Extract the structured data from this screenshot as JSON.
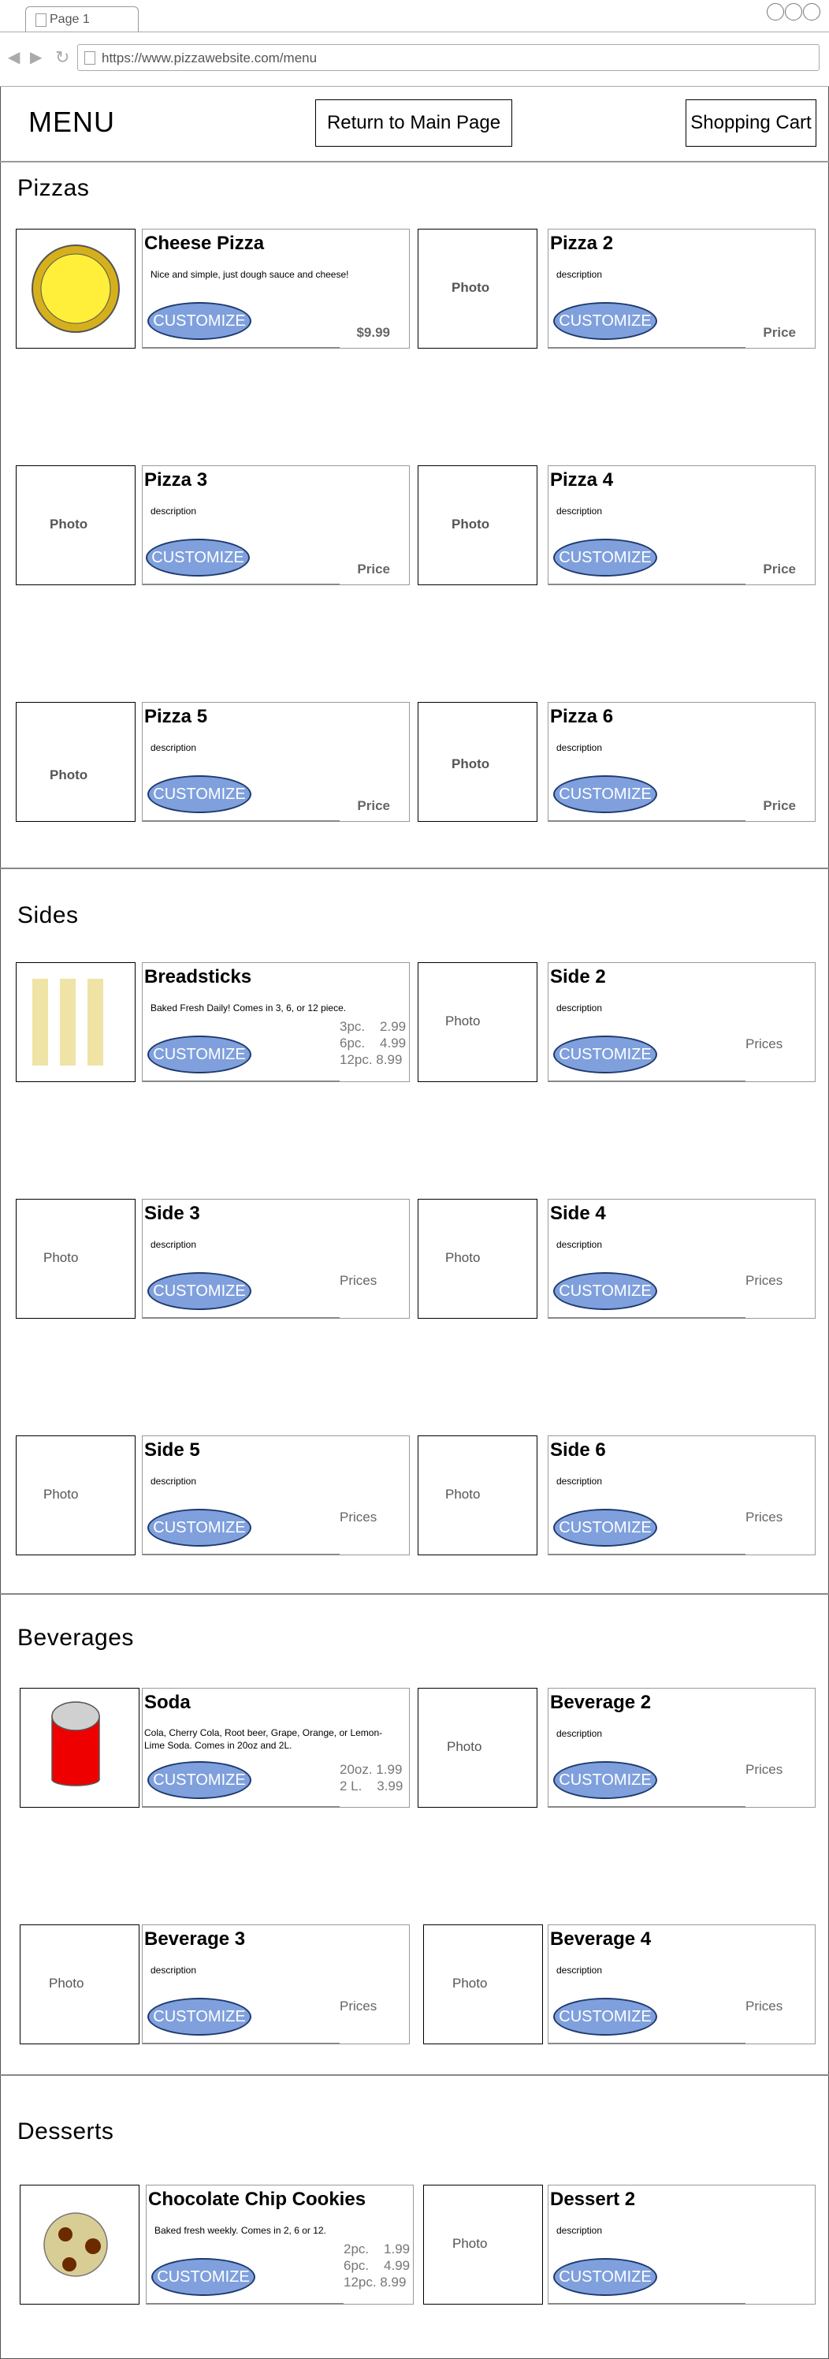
{
  "browser": {
    "tab_label": "Page 1",
    "url": "https://www.pizzawebsite.com/menu",
    "back_icon": "◀",
    "forward_icon": "▶",
    "reload_icon": "↻"
  },
  "header": {
    "title": "MENU",
    "return_button": "Return to Main Page",
    "cart_button": "Shopping Cart"
  },
  "customize_label": "CUSTOMIZE",
  "photo_label": "Photo",
  "sections": {
    "pizzas": {
      "title": "Pizzas",
      "items": [
        {
          "name": "Cheese Pizza",
          "description": "Nice and simple, just dough sauce and cheese!",
          "price": "$9.99"
        },
        {
          "name": "Pizza 2",
          "description": "description",
          "price": "Price"
        },
        {
          "name": "Pizza 3",
          "description": "description",
          "price": "Price"
        },
        {
          "name": "Pizza 4",
          "description": "description",
          "price": "Price"
        },
        {
          "name": "Pizza 5",
          "description": "description",
          "price": "Price"
        },
        {
          "name": "Pizza 6",
          "description": "description",
          "price": "Price"
        }
      ]
    },
    "sides": {
      "title": "Sides",
      "items": [
        {
          "name": "Breadsticks",
          "description": "Baked Fresh Daily! Comes in 3, 6, or 12 piece.",
          "prices": "3pc.    2.99\n6pc.    4.99\n12pc. 8.99"
        },
        {
          "name": "Side 2",
          "description": "description",
          "prices": "Prices"
        },
        {
          "name": "Side 3",
          "description": "description",
          "prices": "Prices"
        },
        {
          "name": "Side 4",
          "description": "description",
          "prices": "Prices"
        },
        {
          "name": "Side 5",
          "description": "description",
          "prices": "Prices"
        },
        {
          "name": "Side 6",
          "description": "description",
          "prices": "Prices"
        }
      ]
    },
    "beverages": {
      "title": "Beverages",
      "items": [
        {
          "name": "Soda",
          "description": "Cola, Cherry Cola, Root beer, Grape, Orange, or Lemon-Lime Soda. Comes in 20oz and 2L.",
          "prices": "20oz. 1.99\n2 L.    3.99"
        },
        {
          "name": "Beverage 2",
          "description": "description",
          "prices": "Prices"
        },
        {
          "name": "Beverage 3",
          "description": "description",
          "prices": "Prices"
        },
        {
          "name": "Beverage 4",
          "description": "description",
          "prices": "Prices"
        }
      ]
    },
    "desserts": {
      "title": "Desserts",
      "items": [
        {
          "name": "Chocolate Chip Cookies",
          "description": "Baked fresh weekly. Comes in 2, 6 or 12.",
          "prices": "2pc.    1.99\n6pc.    4.99\n12pc. 8.99"
        },
        {
          "name": "Dessert 2",
          "description": "description",
          "prices": ""
        }
      ]
    }
  },
  "colors": {
    "customize_fill": "#7fa0dd",
    "customize_border": "#1e3a6e",
    "pizza_cheese": "#ffef3a",
    "pizza_crust": "#d6b01c",
    "breadstick": "#efe3a6",
    "soda_can": "#ee0000",
    "cookie": "#d9cd96",
    "chocolate_chip": "#6b2a00"
  }
}
